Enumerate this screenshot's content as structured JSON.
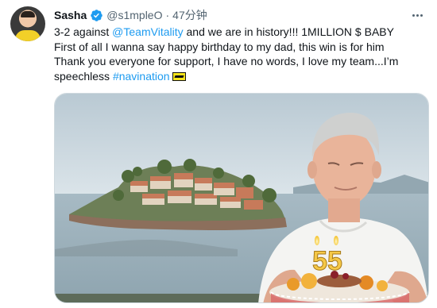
{
  "tweet": {
    "author_name": "Sasha",
    "handle": "@s1mpleO",
    "separator": "·",
    "time": "47分钟",
    "body": {
      "line1_prefix": "3-2 against ",
      "mention": "@TeamVitality",
      "line1_suffix": " and we are in history!!!  1MILLION $ BABY",
      "line2": "First of all I wanna say happy birthday to my dad, this win is for him",
      "line3": "Thank you everyone for support, I have no words, I love my team...I’m",
      "line4_prefix": "speechless ",
      "hashtag": "#navination"
    },
    "media": {
      "cake_number": "55"
    }
  },
  "icons": {
    "verified": "verified-badge-icon",
    "more": "more-options-icon",
    "emoji": "navi-flag-emoji"
  },
  "colors": {
    "link": "#1d9bf0",
    "verified": "#1d9bf0",
    "secondary_text": "#536471"
  }
}
